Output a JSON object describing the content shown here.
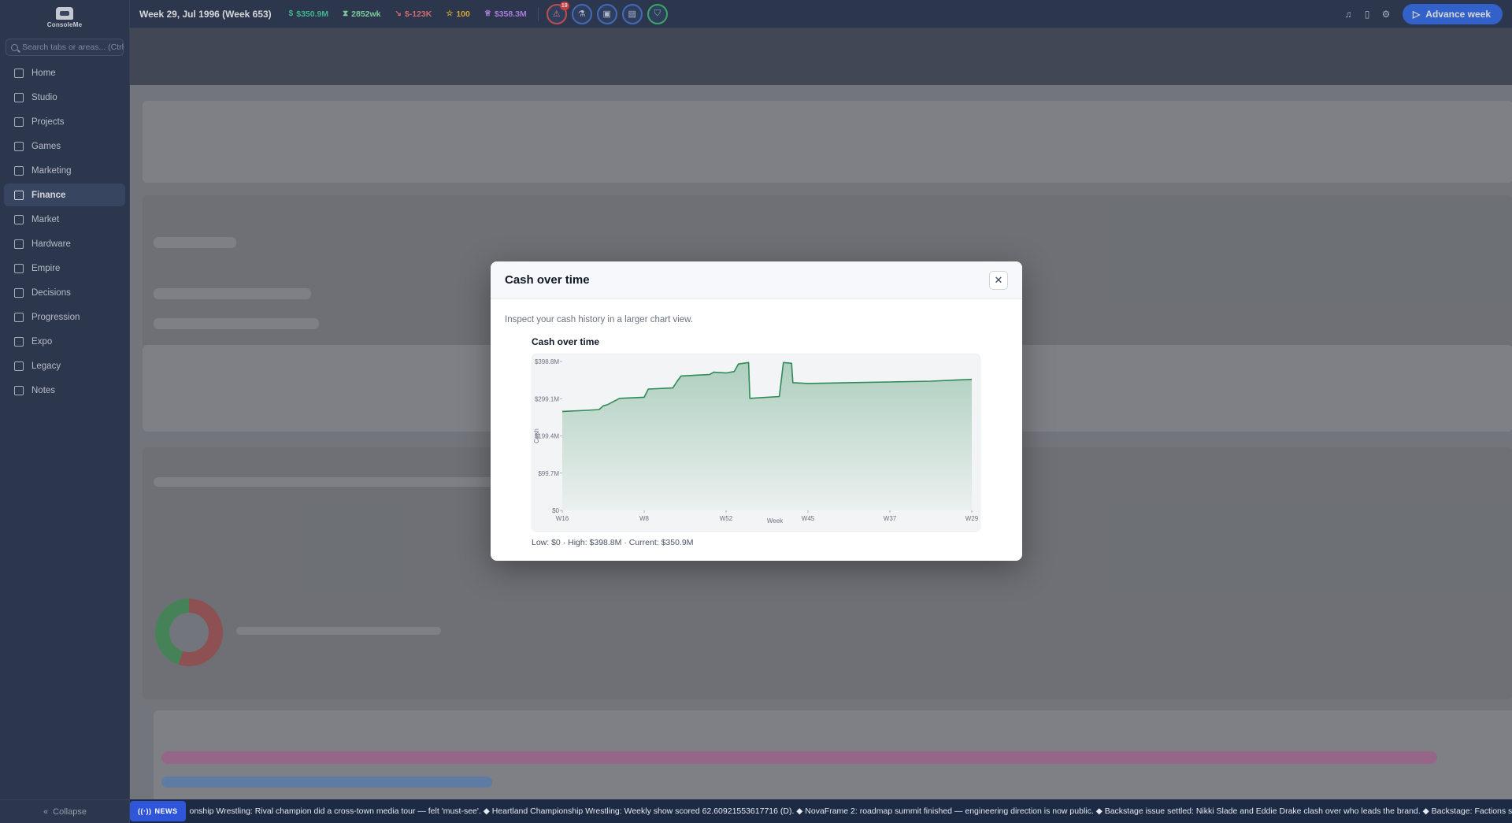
{
  "sidebar": {
    "logo_text": "ConsoleMe",
    "search_placeholder": "Search tabs or areas... (Ctrl+",
    "items": [
      {
        "label": "Home",
        "icon": "home-icon",
        "active": false
      },
      {
        "label": "Studio",
        "icon": "building-icon",
        "active": false
      },
      {
        "label": "Projects",
        "icon": "folder-icon",
        "active": false
      },
      {
        "label": "Games",
        "icon": "gamepad-icon",
        "active": false
      },
      {
        "label": "Marketing",
        "icon": "megaphone-icon",
        "active": false
      },
      {
        "label": "Finance",
        "icon": "bank-icon",
        "active": true
      },
      {
        "label": "Market",
        "icon": "globe-icon",
        "active": false
      },
      {
        "label": "Hardware",
        "icon": "chip-icon",
        "active": false
      },
      {
        "label": "Empire",
        "icon": "crown-icon",
        "active": false
      },
      {
        "label": "Decisions",
        "icon": "warning-triangle-icon",
        "active": false
      },
      {
        "label": "Progression",
        "icon": "flask-icon",
        "active": false
      },
      {
        "label": "Expo",
        "icon": "presentation-icon",
        "active": false
      },
      {
        "label": "Legacy",
        "icon": "book-icon",
        "active": false
      },
      {
        "label": "Notes",
        "icon": "notes-icon",
        "active": false
      }
    ],
    "collapse_label": "Collapse"
  },
  "topbar": {
    "week": "Week 29, Jul 1996 (Week 653)",
    "stats": [
      {
        "icon": "dollar-icon",
        "text": "$350.9M",
        "color": "#34d399"
      },
      {
        "icon": "hourglass-icon",
        "text": "2852wk",
        "color": "#86efac"
      },
      {
        "icon": "trend-down-icon",
        "text": "$-123K",
        "color": "#f87171"
      },
      {
        "icon": "star-icon",
        "text": "100",
        "color": "#fbbf24"
      },
      {
        "icon": "crown-icon",
        "text": "$358.3M",
        "color": "#c084fc"
      }
    ],
    "alert_badge": "19",
    "advance_label": "Advance week",
    "accent": "#2563eb"
  },
  "modal": {
    "title": "Cash over time",
    "close_label": "✕",
    "description": "Inspect your cash history in a larger chart view.",
    "chart_title": "Cash over time",
    "summary": "Low: $0 · High: $398.8M · Current: $350.9M"
  },
  "chart_data": {
    "type": "area",
    "title": "Cash over time",
    "xlabel": "Week",
    "ylabel": "Cash",
    "y_ticks": [
      "$0",
      "$99.7M",
      "$199.4M",
      "$299.1M",
      "$398.8M"
    ],
    "x_ticks": [
      "W16",
      "W8",
      "W52",
      "W45",
      "W37",
      "W29"
    ],
    "ylim": [
      0,
      398.8
    ],
    "y_unit": "$M",
    "color": "#2e8b57",
    "points": [
      {
        "x": 0,
        "y": 265
      },
      {
        "x": 0.06,
        "y": 268
      },
      {
        "x": 0.09,
        "y": 270
      },
      {
        "x": 0.1,
        "y": 280
      },
      {
        "x": 0.11,
        "y": 283
      },
      {
        "x": 0.14,
        "y": 300
      },
      {
        "x": 0.2,
        "y": 303
      },
      {
        "x": 0.21,
        "y": 325
      },
      {
        "x": 0.27,
        "y": 328
      },
      {
        "x": 0.28,
        "y": 345
      },
      {
        "x": 0.29,
        "y": 360
      },
      {
        "x": 0.36,
        "y": 364
      },
      {
        "x": 0.37,
        "y": 370
      },
      {
        "x": 0.4,
        "y": 368
      },
      {
        "x": 0.42,
        "y": 372
      },
      {
        "x": 0.43,
        "y": 392
      },
      {
        "x": 0.455,
        "y": 396
      },
      {
        "x": 0.458,
        "y": 300
      },
      {
        "x": 0.53,
        "y": 305
      },
      {
        "x": 0.54,
        "y": 396
      },
      {
        "x": 0.56,
        "y": 394
      },
      {
        "x": 0.563,
        "y": 342
      },
      {
        "x": 0.6,
        "y": 340
      },
      {
        "x": 0.7,
        "y": 342
      },
      {
        "x": 0.8,
        "y": 344
      },
      {
        "x": 0.9,
        "y": 346
      },
      {
        "x": 0.96,
        "y": 349
      },
      {
        "x": 1.0,
        "y": 350.9
      }
    ]
  },
  "ticker": {
    "tag": "NEWS",
    "text": "onship Wrestling: Rival champion did a cross-town media tour — felt 'must-see'. ◆ Heartland Championship Wrestling: Weekly show scored 62.60921553617716 (D). ◆ NovaFrame 2: roadmap summit finished — engineering direction is now public. ◆ Backstage issue settled: Nikki Slade and Eddie Drake clash over who leads the brand. ◆ Backstage: Factions split the locker room; morale is te"
  }
}
